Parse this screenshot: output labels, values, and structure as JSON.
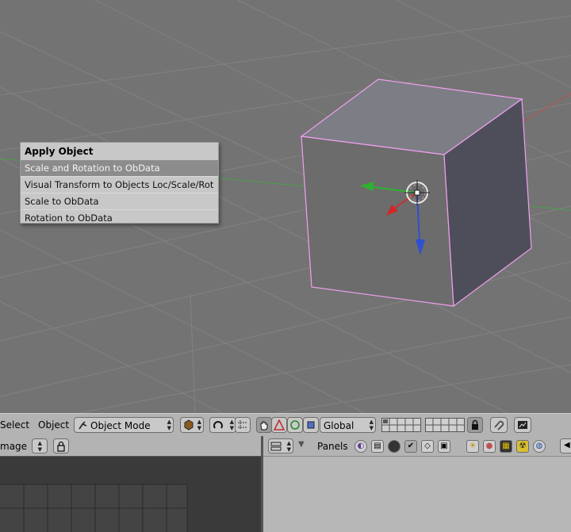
{
  "popup": {
    "title": "Apply Object",
    "items": [
      {
        "label": "Scale and Rotation to ObData",
        "highlighted": true
      },
      {
        "label": "Visual Transform to Objects Loc/Scale/Rot",
        "highlighted": false
      },
      {
        "label": "Scale to ObData",
        "highlighted": false
      },
      {
        "label": "Rotation to ObData",
        "highlighted": false
      }
    ]
  },
  "header": {
    "select_menu": "Select",
    "object_menu": "Object",
    "mode_selector": "Object Mode",
    "orientation": "Global"
  },
  "bottom_left": {
    "menu_label": "mage"
  },
  "bottom_right": {
    "panels_label": "Panels"
  },
  "colors": {
    "selection_outline": "#f0a0f0",
    "x_axis": "#c83030",
    "y_axis": "#30b030",
    "z_axis": "#3050d0",
    "highlight": "#8c8c8c"
  },
  "icons": {
    "mode_icon": "object-mode-icon",
    "pivot": "pivot-icon",
    "manipulator": "hand-icon",
    "lock": "lock-icon"
  }
}
